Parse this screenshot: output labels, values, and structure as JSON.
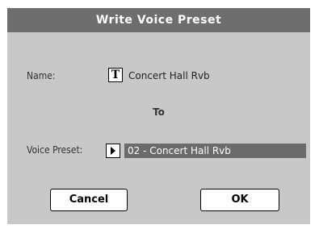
{
  "dialog": {
    "title": "Write Voice Preset"
  },
  "name_row": {
    "label": "Name:",
    "icon": "text-edit-icon",
    "icon_glyph": "T",
    "value": "Concert Hall Rvb"
  },
  "to_label": "To",
  "preset_row": {
    "label": "Voice Preset:",
    "icon": "play-arrow-icon",
    "value": "02 - Concert Hall Rvb"
  },
  "buttons": {
    "cancel_label": "Cancel",
    "ok_label": "OK"
  },
  "colors": {
    "title_bar": "#6e6e6e",
    "dialog_bg": "#c8c8c8",
    "selected_field": "#6b6b6b"
  }
}
